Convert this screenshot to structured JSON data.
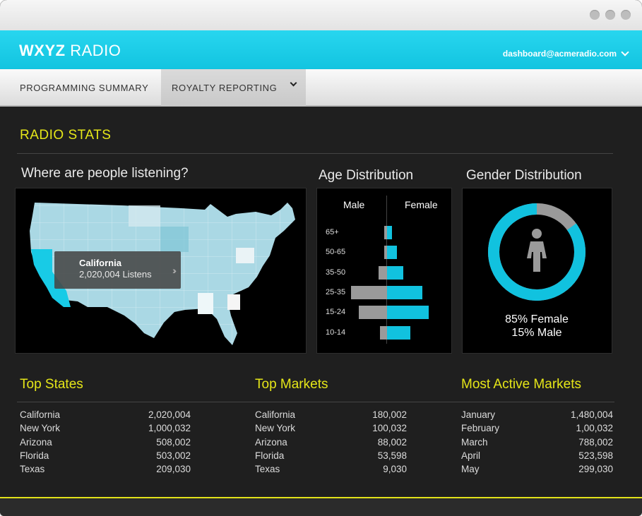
{
  "app": {
    "brand_bold": "WXYZ",
    "brand_light": "RADIO",
    "account_email": "dashboard@acmeradio.com"
  },
  "nav": {
    "tab1": "PROGRAMMING SUMMARY",
    "tab2": "ROYALTY REPORTING"
  },
  "section": {
    "title": "RADIO STATS"
  },
  "map": {
    "title": "Where are people listening?",
    "tooltip_state": "California",
    "tooltip_value": "2,020,004 Listens"
  },
  "age": {
    "title": "Age Distribution",
    "male_label": "Male",
    "female_label": "Female",
    "groups": [
      {
        "label": "65+",
        "male": 4,
        "female": 7
      },
      {
        "label": "50-65",
        "male": 4,
        "female": 14
      },
      {
        "label": "35-50",
        "male": 12,
        "female": 23
      },
      {
        "label": "25-35",
        "male": 51,
        "female": 50
      },
      {
        "label": "15-24",
        "male": 40,
        "female": 59
      },
      {
        "label": "10-14",
        "male": 10,
        "female": 33
      }
    ]
  },
  "gender": {
    "title": "Gender Distribution",
    "female_pct": 85,
    "female_text": "85% Female",
    "male_text": "15% Male"
  },
  "top_states": {
    "title": "Top States",
    "rows": [
      {
        "name": "California",
        "value": "2,020,004"
      },
      {
        "name": "New York",
        "value": "1,000,032"
      },
      {
        "name": "Arizona",
        "value": "508,002"
      },
      {
        "name": "Florida",
        "value": "503,002"
      },
      {
        "name": "Texas",
        "value": "209,030"
      }
    ]
  },
  "top_markets": {
    "title": "Top Markets",
    "rows": [
      {
        "name": "California",
        "value": "180,002"
      },
      {
        "name": "New York",
        "value": "100,032"
      },
      {
        "name": "Arizona",
        "value": "88,002"
      },
      {
        "name": "Florida",
        "value": "53,598"
      },
      {
        "name": "Texas",
        "value": "9,030"
      }
    ]
  },
  "active_markets": {
    "title": "Most Active Markets",
    "rows": [
      {
        "name": "January",
        "value": "1,480,004"
      },
      {
        "name": "February",
        "value": "1,00,032"
      },
      {
        "name": "March",
        "value": "788,002"
      },
      {
        "name": "April",
        "value": "523,598"
      },
      {
        "name": "May",
        "value": "299,030"
      }
    ]
  },
  "colors": {
    "accent_cyan": "#11c2df",
    "accent_yellow": "#e5e618",
    "male_gray": "#9a9a9a"
  }
}
